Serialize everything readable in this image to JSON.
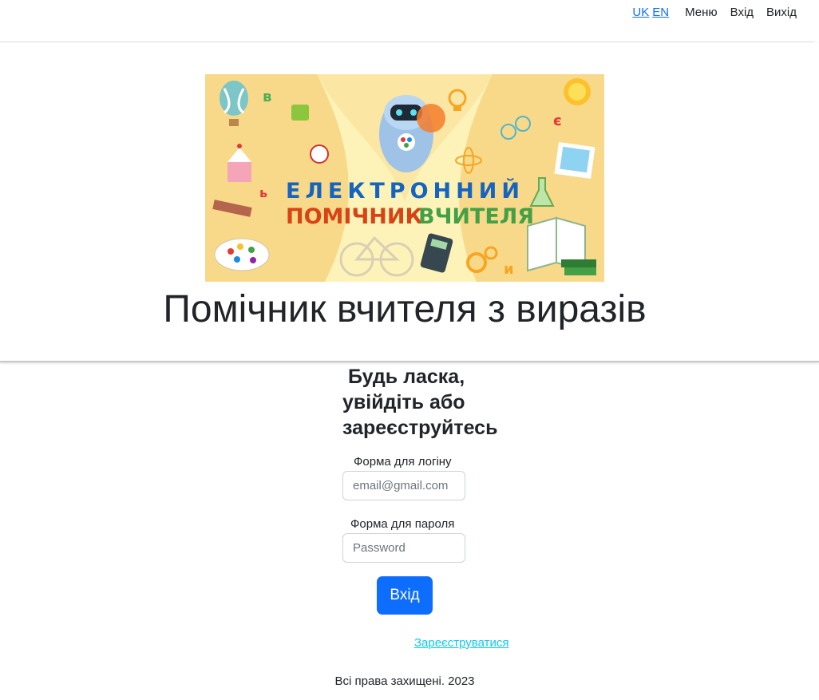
{
  "navbar": {
    "lang_uk": "UK",
    "lang_en": "EN",
    "menu": "Меню",
    "login": "Вхід",
    "logout": "Вихід"
  },
  "hero": {
    "banner_line1": "ЕЛЕКТРОННИЙ",
    "banner_line2_a": "ПОМІЧНИК",
    "banner_line2_b": "ВЧИТЕЛЯ",
    "title": "Помічник вчителя з виразів"
  },
  "login": {
    "heading_line1": "Будь ласка,",
    "heading_line2": "увійдіть або",
    "heading_line3": "зареєструйтесь",
    "email_label": "Форма для логіну",
    "email_placeholder": "email@gmail.com",
    "email_value": "",
    "password_label": "Форма для пароля",
    "password_placeholder": "Password",
    "password_value": "",
    "submit_label": "Вхід",
    "register_label": "Зареєструватися"
  },
  "footer": {
    "text": "Всі права захищені. 2023"
  },
  "colors": {
    "primary": "#0d6efd",
    "link_info": "#0dcaf0",
    "banner_bg": "#fdf0b0"
  }
}
